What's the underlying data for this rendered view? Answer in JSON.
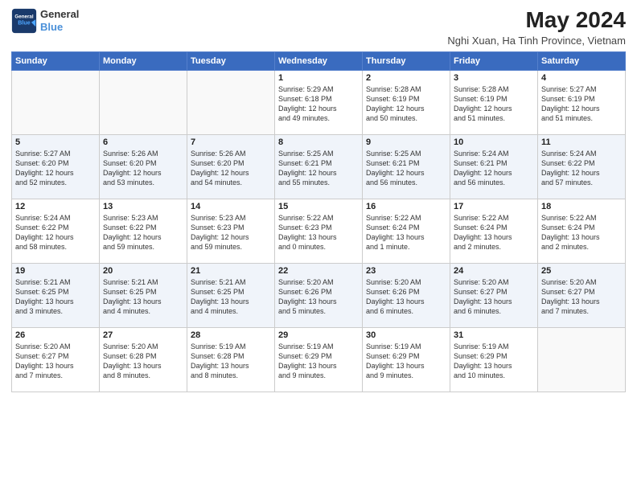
{
  "header": {
    "logo_line1": "General",
    "logo_line2": "Blue",
    "title": "May 2024",
    "subtitle": "Nghi Xuan, Ha Tinh Province, Vietnam"
  },
  "weekdays": [
    "Sunday",
    "Monday",
    "Tuesday",
    "Wednesday",
    "Thursday",
    "Friday",
    "Saturday"
  ],
  "weeks": [
    [
      {
        "day": "",
        "info": ""
      },
      {
        "day": "",
        "info": ""
      },
      {
        "day": "",
        "info": ""
      },
      {
        "day": "1",
        "info": "Sunrise: 5:29 AM\nSunset: 6:18 PM\nDaylight: 12 hours\nand 49 minutes."
      },
      {
        "day": "2",
        "info": "Sunrise: 5:28 AM\nSunset: 6:19 PM\nDaylight: 12 hours\nand 50 minutes."
      },
      {
        "day": "3",
        "info": "Sunrise: 5:28 AM\nSunset: 6:19 PM\nDaylight: 12 hours\nand 51 minutes."
      },
      {
        "day": "4",
        "info": "Sunrise: 5:27 AM\nSunset: 6:19 PM\nDaylight: 12 hours\nand 51 minutes."
      }
    ],
    [
      {
        "day": "5",
        "info": "Sunrise: 5:27 AM\nSunset: 6:20 PM\nDaylight: 12 hours\nand 52 minutes."
      },
      {
        "day": "6",
        "info": "Sunrise: 5:26 AM\nSunset: 6:20 PM\nDaylight: 12 hours\nand 53 minutes."
      },
      {
        "day": "7",
        "info": "Sunrise: 5:26 AM\nSunset: 6:20 PM\nDaylight: 12 hours\nand 54 minutes."
      },
      {
        "day": "8",
        "info": "Sunrise: 5:25 AM\nSunset: 6:21 PM\nDaylight: 12 hours\nand 55 minutes."
      },
      {
        "day": "9",
        "info": "Sunrise: 5:25 AM\nSunset: 6:21 PM\nDaylight: 12 hours\nand 56 minutes."
      },
      {
        "day": "10",
        "info": "Sunrise: 5:24 AM\nSunset: 6:21 PM\nDaylight: 12 hours\nand 56 minutes."
      },
      {
        "day": "11",
        "info": "Sunrise: 5:24 AM\nSunset: 6:22 PM\nDaylight: 12 hours\nand 57 minutes."
      }
    ],
    [
      {
        "day": "12",
        "info": "Sunrise: 5:24 AM\nSunset: 6:22 PM\nDaylight: 12 hours\nand 58 minutes."
      },
      {
        "day": "13",
        "info": "Sunrise: 5:23 AM\nSunset: 6:22 PM\nDaylight: 12 hours\nand 59 minutes."
      },
      {
        "day": "14",
        "info": "Sunrise: 5:23 AM\nSunset: 6:23 PM\nDaylight: 12 hours\nand 59 minutes."
      },
      {
        "day": "15",
        "info": "Sunrise: 5:22 AM\nSunset: 6:23 PM\nDaylight: 13 hours\nand 0 minutes."
      },
      {
        "day": "16",
        "info": "Sunrise: 5:22 AM\nSunset: 6:24 PM\nDaylight: 13 hours\nand 1 minute."
      },
      {
        "day": "17",
        "info": "Sunrise: 5:22 AM\nSunset: 6:24 PM\nDaylight: 13 hours\nand 2 minutes."
      },
      {
        "day": "18",
        "info": "Sunrise: 5:22 AM\nSunset: 6:24 PM\nDaylight: 13 hours\nand 2 minutes."
      }
    ],
    [
      {
        "day": "19",
        "info": "Sunrise: 5:21 AM\nSunset: 6:25 PM\nDaylight: 13 hours\nand 3 minutes."
      },
      {
        "day": "20",
        "info": "Sunrise: 5:21 AM\nSunset: 6:25 PM\nDaylight: 13 hours\nand 4 minutes."
      },
      {
        "day": "21",
        "info": "Sunrise: 5:21 AM\nSunset: 6:25 PM\nDaylight: 13 hours\nand 4 minutes."
      },
      {
        "day": "22",
        "info": "Sunrise: 5:20 AM\nSunset: 6:26 PM\nDaylight: 13 hours\nand 5 minutes."
      },
      {
        "day": "23",
        "info": "Sunrise: 5:20 AM\nSunset: 6:26 PM\nDaylight: 13 hours\nand 6 minutes."
      },
      {
        "day": "24",
        "info": "Sunrise: 5:20 AM\nSunset: 6:27 PM\nDaylight: 13 hours\nand 6 minutes."
      },
      {
        "day": "25",
        "info": "Sunrise: 5:20 AM\nSunset: 6:27 PM\nDaylight: 13 hours\nand 7 minutes."
      }
    ],
    [
      {
        "day": "26",
        "info": "Sunrise: 5:20 AM\nSunset: 6:27 PM\nDaylight: 13 hours\nand 7 minutes."
      },
      {
        "day": "27",
        "info": "Sunrise: 5:20 AM\nSunset: 6:28 PM\nDaylight: 13 hours\nand 8 minutes."
      },
      {
        "day": "28",
        "info": "Sunrise: 5:19 AM\nSunset: 6:28 PM\nDaylight: 13 hours\nand 8 minutes."
      },
      {
        "day": "29",
        "info": "Sunrise: 5:19 AM\nSunset: 6:29 PM\nDaylight: 13 hours\nand 9 minutes."
      },
      {
        "day": "30",
        "info": "Sunrise: 5:19 AM\nSunset: 6:29 PM\nDaylight: 13 hours\nand 9 minutes."
      },
      {
        "day": "31",
        "info": "Sunrise: 5:19 AM\nSunset: 6:29 PM\nDaylight: 13 hours\nand 10 minutes."
      },
      {
        "day": "",
        "info": ""
      }
    ]
  ]
}
